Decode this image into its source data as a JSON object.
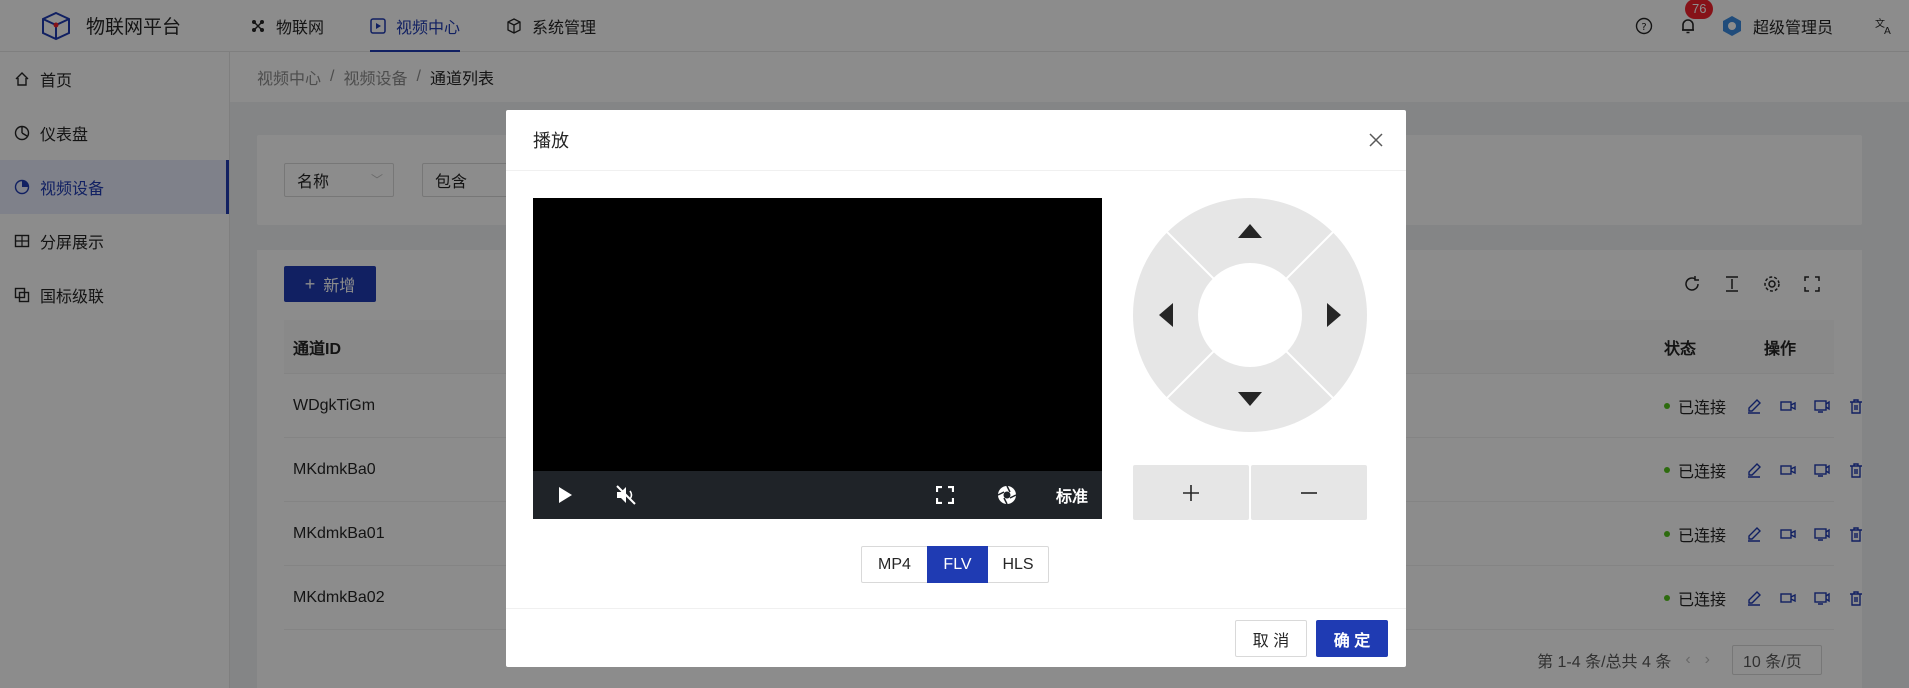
{
  "app": {
    "title": "物联网平台"
  },
  "top_nav": [
    {
      "label": "物联网",
      "icon": "nodes-icon"
    },
    {
      "label": "视频中心",
      "icon": "play-square-icon",
      "active": true
    },
    {
      "label": "系统管理",
      "icon": "cube-icon"
    }
  ],
  "header": {
    "notification_count": "76",
    "user_name": "超级管理员"
  },
  "sidebar": {
    "items": [
      {
        "label": "首页",
        "icon": "home-icon"
      },
      {
        "label": "仪表盘",
        "icon": "dashboard-icon"
      },
      {
        "label": "视频设备",
        "icon": "pie-chart-icon",
        "active": true
      },
      {
        "label": "分屏展示",
        "icon": "split-screen-icon"
      },
      {
        "label": "国标级联",
        "icon": "cascade-icon"
      }
    ]
  },
  "breadcrumb": [
    "视频中心",
    "视频设备",
    "通道列表"
  ],
  "filter": {
    "field": "名称",
    "operator": "包含"
  },
  "toolbar": {
    "add_label": "新增"
  },
  "table": {
    "headers": {
      "id": "通道ID",
      "status": "状态",
      "ops": "操作"
    },
    "rows": [
      {
        "id": "WDgkTiGm",
        "status": "已连接"
      },
      {
        "id": "MKdmkBa0",
        "status": "已连接"
      },
      {
        "id": "MKdmkBa01",
        "status": "已连接"
      },
      {
        "id": "MKdmkBa02",
        "status": "已连接"
      }
    ]
  },
  "pagination": {
    "summary": "第 1-4 条/总共 4 条",
    "page_size": "10 条/页"
  },
  "modal": {
    "title": "播放",
    "quality": "标准",
    "formats": [
      "MP4",
      "FLV",
      "HLS"
    ],
    "active_format": "FLV",
    "cancel_label": "取 消",
    "ok_label": "确 定"
  },
  "colors": {
    "primary": "#1f3bb3",
    "success": "#52c41a",
    "danger": "#f5222d"
  }
}
